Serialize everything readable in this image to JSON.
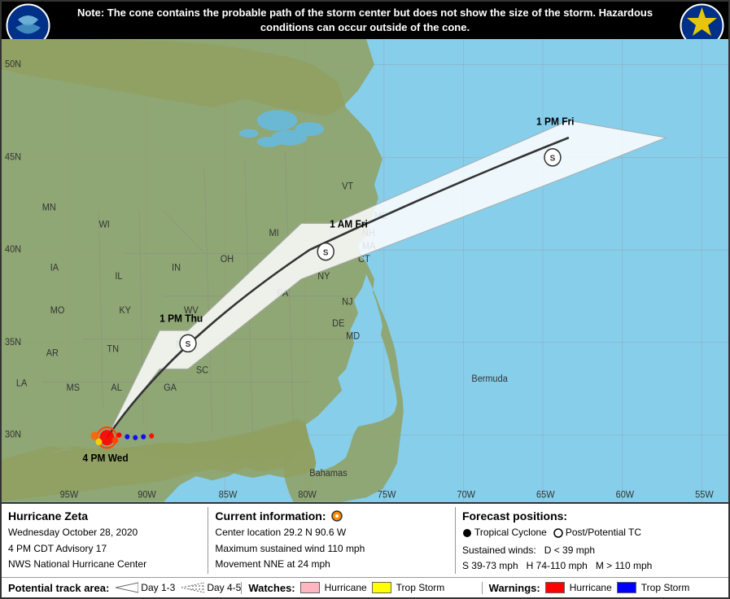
{
  "note": {
    "text": "Note: The cone contains the probable path of the storm center but does not show the size of the storm. Hazardous conditions can occur outside of the cone."
  },
  "storm": {
    "name": "Hurricane Zeta",
    "date": "Wednesday October 28, 2020",
    "advisory": "4 PM CDT Advisory 17",
    "center": "NWS National Hurricane Center"
  },
  "current_info": {
    "label": "Current information:",
    "center_location": "Center location 29.2 N 90.6 W",
    "max_wind": "Maximum sustained wind 110 mph",
    "movement": "Movement NNE at 24 mph"
  },
  "forecast_positions": {
    "label": "Forecast positions:",
    "tc_label": "Tropical Cyclone",
    "potential_tc_label": "Post/Potential TC",
    "winds_label": "Sustained winds:",
    "d_label": "D < 39 mph",
    "s_label": "S 39-73 mph",
    "h_label": "H 74-110 mph",
    "m_label": "M > 110 mph"
  },
  "track_area": {
    "label": "Potential track area:",
    "day1_3": "Day 1-3",
    "day4_5": "Day 4-5"
  },
  "watches": {
    "label": "Watches:",
    "hurricane": "Hurricane",
    "trop_storm": "Trop Storm"
  },
  "warnings": {
    "label": "Warnings:",
    "hurricane": "Hurricane",
    "trop_storm": "Trop Storm"
  },
  "time_labels": {
    "current": "4 PM Wed",
    "t1": "1 PM Thu",
    "t2": "1 AM Fri",
    "t3": "1 PM Fri"
  },
  "grid": {
    "lat_labels": [
      "50N",
      "45N",
      "40N",
      "35N",
      "30N"
    ],
    "lon_labels": [
      "95W",
      "90W",
      "85W",
      "80W",
      "75W",
      "70W",
      "65W",
      "60W",
      "55W"
    ]
  },
  "logos": {
    "noaa": "NOAA",
    "nws": "National Weather Service"
  }
}
